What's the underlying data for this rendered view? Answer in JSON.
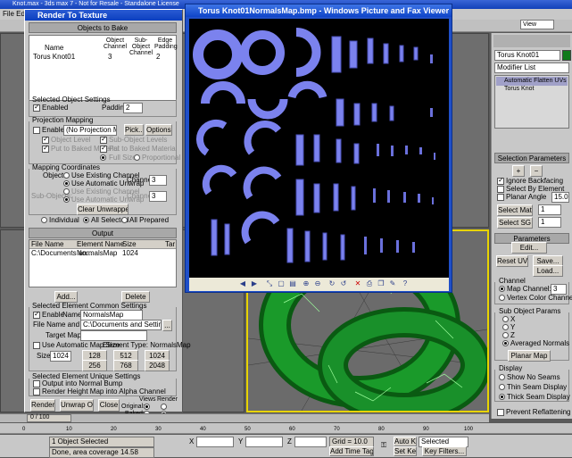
{
  "max_title": "Knot.max - 3ds max 7 - Not for Resale - Standalone License",
  "max_menu": "File  Edit",
  "rtt": {
    "title": "Render To Texture",
    "objects_to_bake": "Objects to Bake",
    "col_name": "Name",
    "col_object_channel": "Object Channel",
    "col_subobject_channel": "Sub-Object Channel",
    "col_edge_padding": "Edge Padding",
    "row_name": "Torus Knot01",
    "row_obj_ch": "3",
    "row_sub_ch": "",
    "row_padding": "2",
    "sel_obj_settings": "Selected Object Settings",
    "enabled": "Enabled",
    "padding": "Padding:",
    "padding_val": "2",
    "proj_mapping": "Projection Mapping",
    "proj_enabled": "Enabled",
    "no_proj_modifier": "(No Projection Modifier",
    "pick": "Pick...",
    "options": "Options...",
    "object_level": "Object Level",
    "sub_object_levels": "Sub-Object Levels",
    "put_to_baked": "Put to Baked Material",
    "put_to_baked2": "Put to Baked Material",
    "full_size": "Full Size",
    "proportional": "Proportional",
    "mapping_coords": "Mapping Coordinates",
    "object_lbl": "Object:",
    "use_existing": "Use Existing Channel",
    "use_auto": "Use Automatic Unwrap",
    "channel": "Channel:",
    "channel_val": "3",
    "sub_objects": "Sub-Objects:",
    "use_existing2": "Use Existing Channel",
    "use_auto2": "Use Automatic Unwrap",
    "channel2": "Channel:",
    "channel2_val": "3",
    "clear_unwrappers": "Clear Unwrappers",
    "individual": "Individual",
    "all_selected": "All Selected",
    "all_prepared": "All Prepared",
    "output": "Output",
    "out_col_file": "File Name",
    "out_col_element": "Element Name",
    "out_col_size": "Size",
    "out_col_tar": "Tar",
    "out_file": "C:\\Documents an...",
    "out_element": "NormalsMap",
    "out_size": "1024",
    "add": "Add...",
    "delete": "Delete",
    "sel_element_common": "Selected Element Common Settings",
    "elem_enable": "Enable",
    "name_lbl": "Name:",
    "name_val": "NormalsMap",
    "file_name_type": "File Name and Type:",
    "file_val": "C:\\Documents and Settings\\Skyler\\",
    "target_map_slot": "Target Map Slot:",
    "use_auto_map_size": "Use Automatic Map Size",
    "element_type": "Element Type: NormalsMap",
    "size_lbl": "Size:",
    "size_val": "1024",
    "s128": "128",
    "s512": "512",
    "s1024": "1024",
    "s256": "256",
    "s768": "768",
    "s2048": "2048",
    "sel_element_unique": "Selected Element Unique Settings",
    "output_into_normal": "Output into Normal Bump",
    "render_height": "Render Height Map into Alpha Channel",
    "render": "Render",
    "unwrap_only": "Unwrap Only",
    "close": "Close",
    "views_lbl": "Views",
    "render_lbl": "Render",
    "original": "Original:",
    "baked": "Baked:"
  },
  "viewer": {
    "title": "Torus Knot01NormalsMap.bmp - Windows Picture and Fax Viewer",
    "toolbar_icons": [
      "prev",
      "next",
      "best-fit",
      "actual-size",
      "slideshow",
      "zoom-in",
      "zoom-out",
      "rotate-cw",
      "rotate-ccw",
      "delete",
      "print",
      "copy",
      "edit",
      "help"
    ]
  },
  "cmd": {
    "object_name": "Torus Knot01",
    "modifier_list": "Modifier List",
    "stack": [
      "Automatic Flatten UVs",
      "Torus Knot"
    ],
    "selection_params": "Selection Parameters",
    "ignore_backfacing": "Ignore Backfacing",
    "select_by_element": "Select By Element",
    "planar_angle": "Planar Angle",
    "planar_angle_val": "15.0",
    "select_matid": "Select MatID",
    "select_sg": "Select SG",
    "matid_val": "1",
    "sg_val": "1",
    "parameters": "Parameters",
    "edit": "Edit...",
    "reset_uvws": "Reset UVWs",
    "save": "Save...",
    "load": "Load...",
    "channel_grp": "Channel",
    "map_channel": "Map Channel:",
    "map_channel_val": "3",
    "vertex_color_channel": "Vertex Color Channel",
    "sub_object_params": "Sub Object Params",
    "x": "X",
    "y": "Y",
    "z": "Z",
    "averaged_normals": "Averaged Normals",
    "planar_map": "Planar Map",
    "display": "Display",
    "show_no_seams": "Show No Seams",
    "thin_seam": "Thin Seam Display",
    "thick_seam": "Thick Seam Display",
    "prevent_reflattening": "Prevent Reflattening"
  },
  "top_view_dropdown": "View",
  "timeline": "0 / 100",
  "ticks": [
    "0",
    "10",
    "20",
    "30",
    "40",
    "50",
    "60",
    "70",
    "80",
    "90",
    "100"
  ],
  "status": {
    "selected": "1 Object Selected",
    "done": "Done, area coverage 14.58",
    "x_lbl": "X",
    "y_lbl": "Y",
    "z_lbl": "Z",
    "grid": "Grid = 10.0",
    "add_time_tag": "Add Time Tag",
    "auto_key": "Auto Key",
    "set_key": "Set Key",
    "selected_dd": "Selected",
    "key_filters": "Key Filters..."
  },
  "colors": {
    "viewport_border": "#e8d400",
    "knot": "#0f7a1a",
    "uv_bg": "#000000",
    "uv_islands": "#7b82ee",
    "titlebar": "#1f4fc8"
  }
}
